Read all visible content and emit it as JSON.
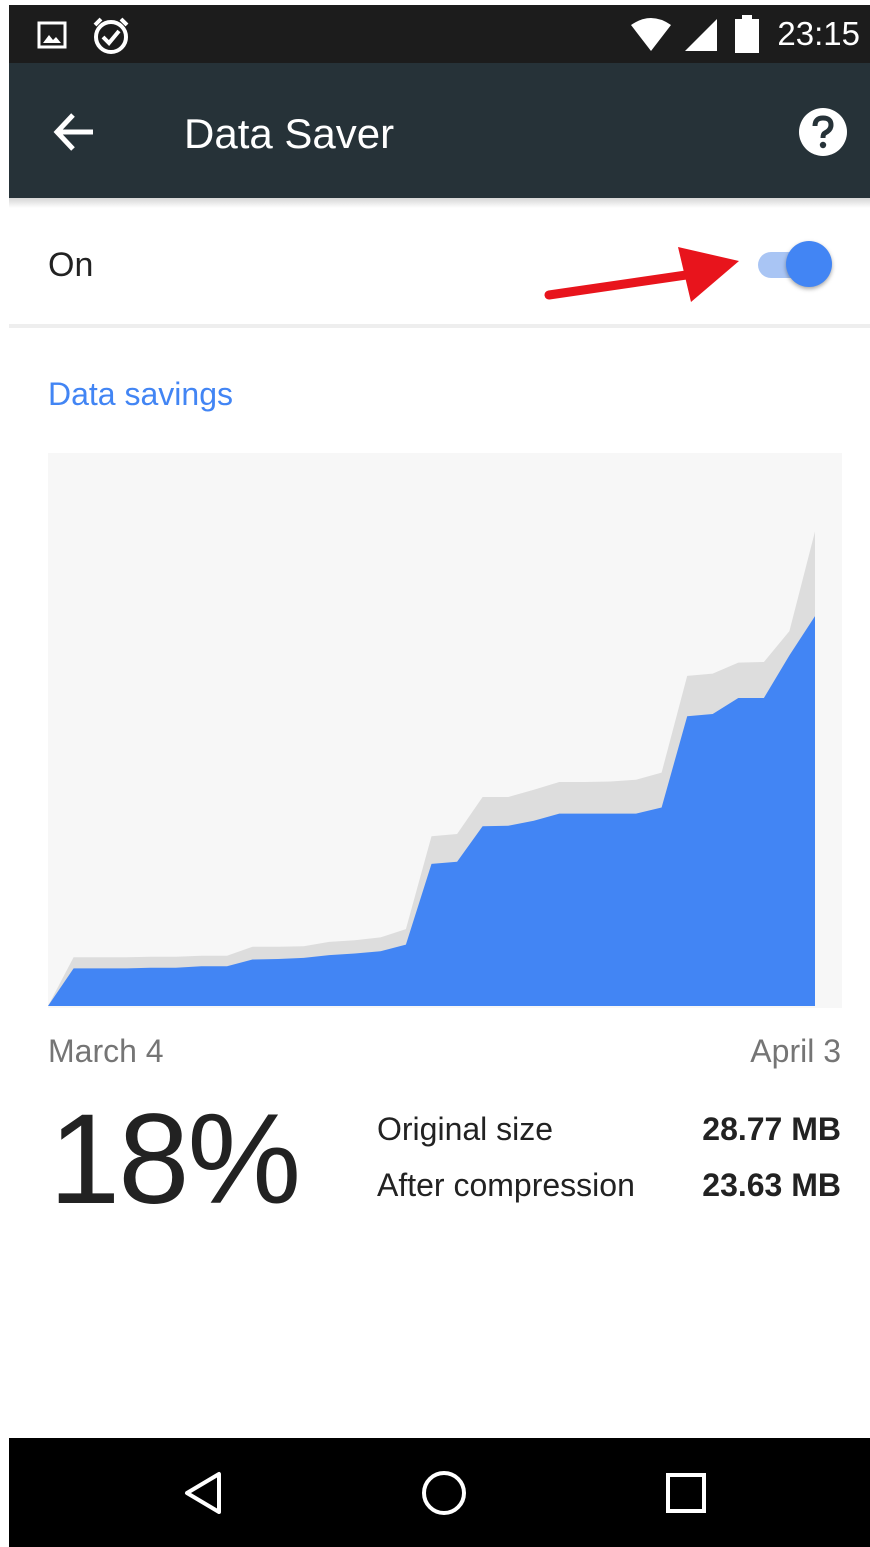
{
  "status_bar": {
    "time": "23:15",
    "icons": [
      "image-icon",
      "alarm-icon",
      "wifi-icon",
      "signal-icon",
      "battery-icon"
    ]
  },
  "toolbar": {
    "title": "Data Saver",
    "back_icon": "arrow-left-icon",
    "help_icon": "help-circle-icon"
  },
  "toggle_row": {
    "label": "On",
    "checked": true
  },
  "section": {
    "title": "Data savings"
  },
  "chart_data": {
    "type": "area",
    "x_start_label": "March 4",
    "x_end_label": "April 3",
    "days": 30,
    "series": [
      {
        "values": [
          0.0,
          0.68,
          0.68,
          0.68,
          0.69,
          0.69,
          0.72,
          0.72,
          0.84,
          0.85,
          0.87,
          0.92,
          0.95,
          0.99,
          1.11,
          2.57,
          2.61,
          3.25,
          3.26,
          3.35,
          3.48,
          3.48,
          3.48,
          3.48,
          3.59,
          5.24,
          5.28,
          5.57,
          5.57,
          6.34,
          7.05
        ]
      },
      {
        "values": [
          0.0,
          0.88,
          0.88,
          0.88,
          0.89,
          0.89,
          0.91,
          0.91,
          1.07,
          1.07,
          1.08,
          1.16,
          1.19,
          1.24,
          1.39,
          3.07,
          3.11,
          3.78,
          3.78,
          3.91,
          4.05,
          4.05,
          4.06,
          4.09,
          4.22,
          5.97,
          6.01,
          6.21,
          6.22,
          6.78,
          8.58
        ]
      }
    ],
    "colors": [
      "#4285f4",
      "#dddddd"
    ],
    "background": "#f7f7f7"
  },
  "summary": {
    "percent": "18%",
    "stats": [
      {
        "label": "Original size",
        "value": "28.77 MB"
      },
      {
        "label": "After compression",
        "value": "23.63 MB"
      }
    ]
  },
  "nav_bar": {
    "icons": [
      "back-triangle-icon",
      "home-circle-icon",
      "recents-square-icon"
    ]
  },
  "colors": {
    "accent": "#4285f4",
    "toolbar": "#263238",
    "arrow": "#e8141c"
  }
}
